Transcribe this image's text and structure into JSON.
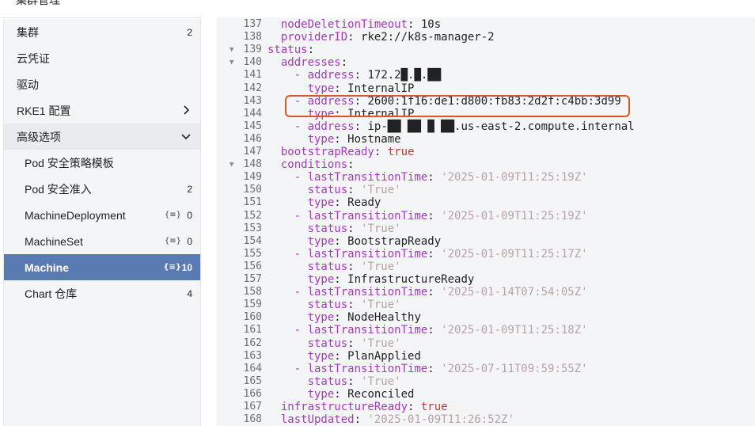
{
  "page": {
    "title": "集群管理"
  },
  "sidebar": {
    "items": [
      {
        "label": "集群",
        "count": "2",
        "top": 0
      },
      {
        "label": "云凭证"
      },
      {
        "label": "驱动"
      },
      {
        "label": "RKE1 配置"
      },
      {
        "label": "高级选项"
      },
      {
        "label": "Pod 安全策略模板"
      },
      {
        "label": "Pod 安全准入",
        "count": "2"
      },
      {
        "label": "MachineDeployment",
        "ns": "{≡}",
        "count": "0"
      },
      {
        "label": "MachineSet",
        "ns": "{≡}",
        "count": "0"
      },
      {
        "label": "Machine",
        "ns": "{≡}",
        "count": "10"
      },
      {
        "label": "Chart 仓库",
        "count": "4"
      }
    ]
  },
  "editor": {
    "lines": [
      {
        "n": "137",
        "t": "  nodeDeletionTimeout: 10s"
      },
      {
        "n": "138",
        "t": "  providerID: rke2://k8s-manager-2"
      },
      {
        "n": "139",
        "t": "status:"
      },
      {
        "n": "140",
        "t": "  addresses:"
      },
      {
        "n": "141",
        "t": "    - address: 172.2█.█.██"
      },
      {
        "n": "142",
        "t": "      type: InternalIP"
      },
      {
        "n": "143",
        "t": "    - address: 2600:1f16:de1:d800:fb83:2d2f:c4bb:3d99"
      },
      {
        "n": "144",
        "t": "      type: InternalIP"
      },
      {
        "n": "145",
        "t": "    - address: ip-██ ██ █ ██.us-east-2.compute.internal"
      },
      {
        "n": "146",
        "t": "      type: Hostname"
      },
      {
        "n": "147",
        "t": "  bootstrapReady: true"
      },
      {
        "n": "148",
        "t": "  conditions:"
      },
      {
        "n": "149",
        "t": "    - lastTransitionTime: '2025-01-09T11:25:19Z'"
      },
      {
        "n": "150",
        "t": "      status: 'True'"
      },
      {
        "n": "151",
        "t": "      type: Ready"
      },
      {
        "n": "152",
        "t": "    - lastTransitionTime: '2025-01-09T11:25:19Z'"
      },
      {
        "n": "153",
        "t": "      status: 'True'"
      },
      {
        "n": "154",
        "t": "      type: BootstrapReady"
      },
      {
        "n": "155",
        "t": "    - lastTransitionTime: '2025-01-09T11:25:17Z'"
      },
      {
        "n": "156",
        "t": "      status: 'True'"
      },
      {
        "n": "157",
        "t": "      type: InfrastructureReady"
      },
      {
        "n": "158",
        "t": "    - lastTransitionTime: '2025-01-14T07:54:05Z'"
      },
      {
        "n": "159",
        "t": "      status: 'True'"
      },
      {
        "n": "160",
        "t": "      type: NodeHealthy"
      },
      {
        "n": "161",
        "t": "    - lastTransitionTime: '2025-01-09T11:25:18Z'"
      },
      {
        "n": "162",
        "t": "      status: 'True'"
      },
      {
        "n": "163",
        "t": "      type: PlanApplied"
      },
      {
        "n": "164",
        "t": "    - lastTransitionTime: '2025-07-11T09:59:55Z'"
      },
      {
        "n": "165",
        "t": "      status: 'True'"
      },
      {
        "n": "166",
        "t": "      type: Reconciled"
      },
      {
        "n": "167",
        "t": "  infrastructureReady: true"
      },
      {
        "n": "168",
        "t": "  lastUpdated: '2025-01-09T11:26:52Z'"
      }
    ]
  }
}
